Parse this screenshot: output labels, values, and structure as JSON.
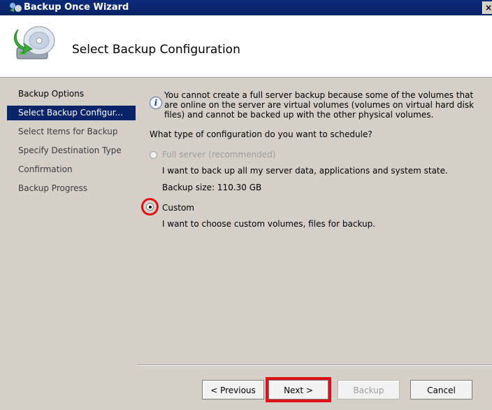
{
  "window": {
    "title": "Backup Once Wizard",
    "close_glyph": "×"
  },
  "header": {
    "page_title": "Select Backup Configuration",
    "icon": "backup-disk-icon"
  },
  "sidebar": {
    "steps": [
      {
        "label": "Backup Options",
        "state": "done"
      },
      {
        "label": "Select Backup Configur...",
        "state": "active"
      },
      {
        "label": "Select Items for Backup",
        "state": "pending"
      },
      {
        "label": "Specify Destination Type",
        "state": "pending"
      },
      {
        "label": "Confirmation",
        "state": "pending"
      },
      {
        "label": "Backup Progress",
        "state": "pending"
      }
    ]
  },
  "main": {
    "info_text": "You cannot create a full server backup because some of the volumes that are online on the server are virtual volumes (volumes on virtual hard disk files) and cannot be backed up with the other physical volumes.",
    "question": "What type of configuration do you want to schedule?",
    "options": {
      "full": {
        "label": "Full server (recommended)",
        "description": "I want to back up all my server data, applications and system state.",
        "backup_size": "Backup size: 110.30 GB",
        "enabled": false,
        "selected": false
      },
      "custom": {
        "label": "Custom",
        "description": "I want to choose custom volumes, files for backup.",
        "enabled": true,
        "selected": true
      }
    }
  },
  "buttons": {
    "previous": "< Previous",
    "next": "Next >",
    "backup": "Backup",
    "cancel": "Cancel"
  },
  "colors": {
    "title_bar": "#0a246a",
    "active_step": "#0a246a",
    "annotation": "#e0101a"
  }
}
